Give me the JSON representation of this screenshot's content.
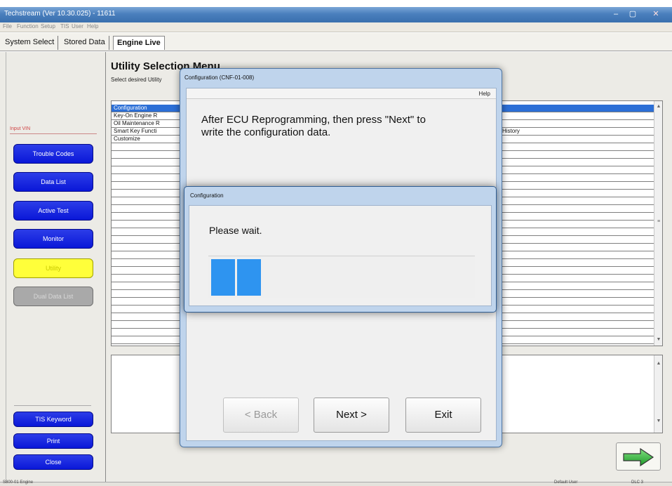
{
  "window": {
    "title": "Techstream (Ver 10.30.025) - 11611",
    "minimize": "–",
    "maximize": "▢",
    "close": "✕"
  },
  "menu": [
    "File",
    "Function",
    "Setup",
    "TIS",
    "User",
    "Help"
  ],
  "tabs": [
    "System Select",
    "Stored Data",
    "Engine Live"
  ],
  "sidebar": {
    "input_vin": "Input VIN",
    "buttons": [
      "Trouble Codes",
      "Data List",
      "Active Test",
      "Monitor",
      "Utility",
      "Dual Data List"
    ],
    "bottom_buttons": [
      "TIS Keyword",
      "Print",
      "Close"
    ]
  },
  "utility": {
    "title": "Utility Selection Menu",
    "subtitle": "Select desired Utility",
    "items": [
      "Configuration",
      "Key-On Engine R",
      "Oil Maintenance R",
      "Smart Key Functi",
      "Customize"
    ],
    "history_text": "History"
  },
  "dialog": {
    "title": "Configuration (CNF-01-008)",
    "help": "Help",
    "message_line1": "After ECU Reprogramming, then press \"Next\" to",
    "message_line2": "write the configuration data.",
    "back": "< Back",
    "next": "Next >",
    "exit": "Exit"
  },
  "progress": {
    "title": "Configuration",
    "message": "Please wait.",
    "filled_blocks": 2,
    "block_color": "#2e94f0"
  },
  "statusbar": {
    "left": "S800-01  Engine",
    "user": "Default User",
    "dlc": "DLC 3"
  }
}
